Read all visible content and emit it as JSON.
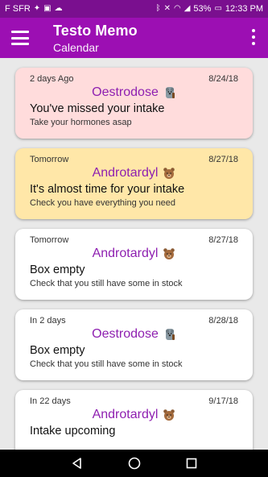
{
  "status_bar": {
    "carrier": "F SFR",
    "battery": "53%",
    "time": "12:33 PM"
  },
  "app_bar": {
    "title": "Testo Memo",
    "subtitle": "Calendar"
  },
  "cards": [
    {
      "when": "2 days Ago",
      "date": "8/24/18",
      "drug": "Oestrodose",
      "drug_icon": "koala-icon",
      "title": "You've missed your intake",
      "desc": "Take your hormones asap",
      "state": "overdue",
      "color": "#ffdcdc"
    },
    {
      "when": "Tomorrow",
      "date": "8/27/18",
      "drug": "Androtardyl",
      "drug_icon": "bear-icon",
      "title": "It's almost time for your intake",
      "desc": "Check you have everything you need",
      "state": "soon",
      "color": "#ffe7a8"
    },
    {
      "when": "Tomorrow",
      "date": "8/27/18",
      "drug": "Androtardyl",
      "drug_icon": "bear-icon",
      "title": "Box empty",
      "desc": "Check that you still have some in stock",
      "state": "normal",
      "color": "#ffffff"
    },
    {
      "when": "In 2 days",
      "date": "8/28/18",
      "drug": "Oestrodose",
      "drug_icon": "koala-icon",
      "title": "Box empty",
      "desc": "Check that you still have some in stock",
      "state": "normal",
      "color": "#ffffff"
    },
    {
      "when": "In 22 days",
      "date": "9/17/18",
      "drug": "Androtardyl",
      "drug_icon": "bear-icon",
      "title": "Intake upcoming",
      "desc": "",
      "state": "normal",
      "color": "#ffffff"
    }
  ],
  "colors": {
    "status_bar": "#7a0f8f",
    "app_bar": "#9c0fb3",
    "drug_text": "#8e1fb0"
  }
}
